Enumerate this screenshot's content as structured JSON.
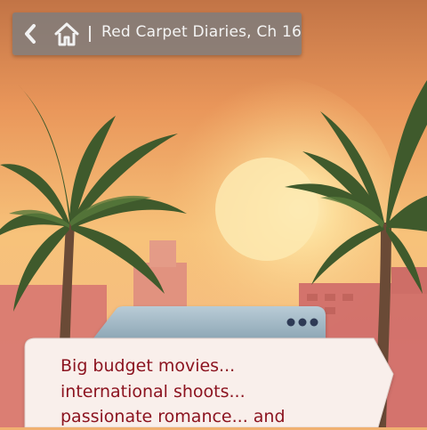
{
  "header": {
    "back_icon": "chevron-left-icon",
    "home_icon": "home-icon",
    "title": "Red Carpet Diaries, Ch 16"
  },
  "dialogue": {
    "lines": [
      "Big budget movies...",
      "international shoots...",
      "passionate romance... and"
    ],
    "more_icon": "more-dots-icon",
    "text_color": "#8c1420"
  },
  "colors": {
    "sky_top": "#c87a4a",
    "sun": "#fde7a8",
    "panel": "#f9efeb"
  }
}
